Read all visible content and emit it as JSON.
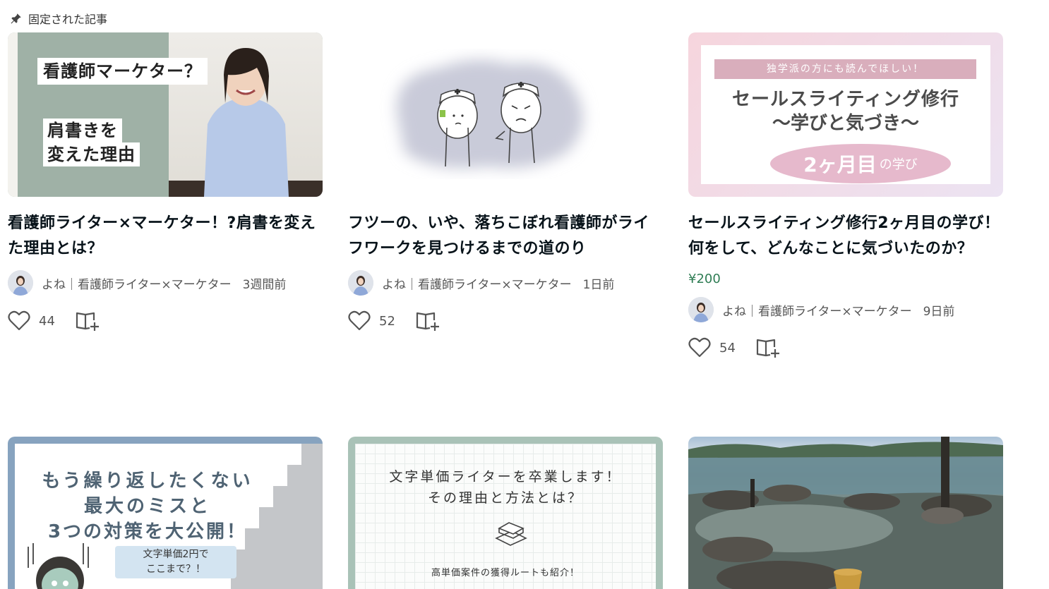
{
  "pinned": {
    "label": "固定された記事"
  },
  "articles": [
    {
      "title": "看護師ライター×マーケター！?肩書を変えた理由とは？",
      "thumb_text": [
        "看護師マーケター？",
        "肩書きを",
        "変えた理由"
      ],
      "author": "よね｜看護師ライター×マーケター",
      "time": "3週間前",
      "likes": "44",
      "price": ""
    },
    {
      "title": "フツーの、いや、落ちこぼれ看護師がライフワークを見つけるまでの道のり",
      "thumb_text": [],
      "author": "よね｜看護師ライター×マーケター",
      "time": "1日前",
      "likes": "52",
      "price": ""
    },
    {
      "title": "セールスライティング修行2ヶ月目の学び！何をして、どんなことに気づいたのか？",
      "thumb_text": [
        "独学派の方にも読んでほしい！",
        "セールスライティング修行",
        "〜学びと気づき〜",
        "2ヶ月目",
        "の学び"
      ],
      "author": "よね｜看護師ライター×マーケター",
      "time": "9日前",
      "likes": "54",
      "price": "¥200"
    },
    {
      "thumb_text": [
        "もう繰り返したくない",
        "最大のミスと",
        "3つの対策を大公開！",
        "文字単価2円で",
        "ここまで？！"
      ]
    },
    {
      "thumb_text": [
        "文字単価ライターを卒業します！",
        "その理由と方法とは？",
        "高単価案件の獲得ルートも紹介！"
      ]
    },
    {
      "thumb_text": []
    }
  ],
  "colors": {
    "price": "#2f7d54",
    "text": "#08131a",
    "meta": "#555555"
  }
}
